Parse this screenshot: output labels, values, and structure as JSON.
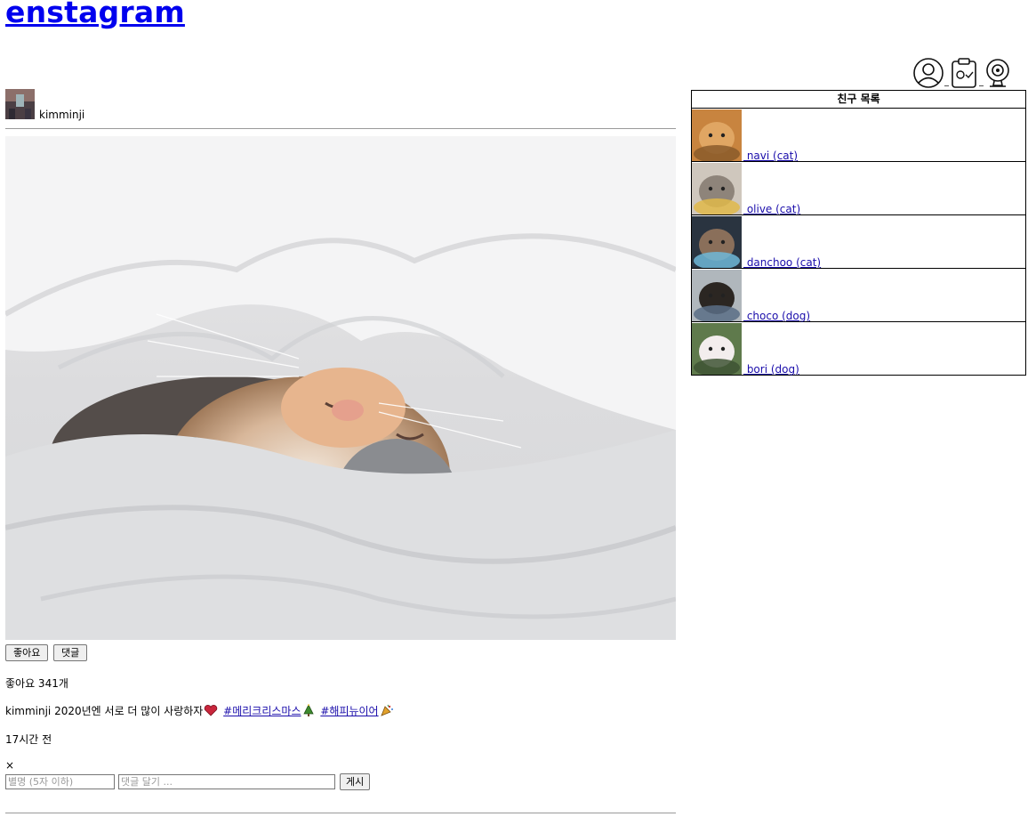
{
  "app": {
    "logo_text": "enstagram"
  },
  "nav": {
    "icons": [
      "profile-icon",
      "clipboard-check-icon",
      "webcam-icon"
    ]
  },
  "post": {
    "username": "kimminji",
    "actions": {
      "like_label": "좋아요",
      "comment_label": "댓글"
    },
    "likes_text": "좋아요 341개",
    "caption_author": "kimminji",
    "caption_text": " 2020년엔 서로 더 많이 사랑하자",
    "hashtags": [
      "#메리크리스마스",
      "#해피뉴이어"
    ],
    "time_text": "17시간 전",
    "close_symbol": "×",
    "comment_form": {
      "nickname_placeholder": "별명 (5자 이하)",
      "comment_placeholder": "댓글 달기 ...",
      "submit_label": "게시"
    }
  },
  "friends": {
    "title": "친구 목록",
    "items": [
      {
        "label": "navi (cat)",
        "colors": [
          "#c8843f",
          "#e0a663",
          "#8a5a2a"
        ]
      },
      {
        "label": "olive (cat)",
        "colors": [
          "#cfc7bd",
          "#8e847a",
          "#e0b84a"
        ]
      },
      {
        "label": "danchoo (cat)",
        "colors": [
          "#2a3440",
          "#8a6f5a",
          "#6fb8d8"
        ]
      },
      {
        "label": "choco (dog)",
        "colors": [
          "#b0b7bc",
          "#2b2622",
          "#5a6f86"
        ]
      },
      {
        "label": "bori (dog)",
        "colors": [
          "#5f7a4c",
          "#f3eded",
          "#3e5434"
        ]
      }
    ]
  }
}
